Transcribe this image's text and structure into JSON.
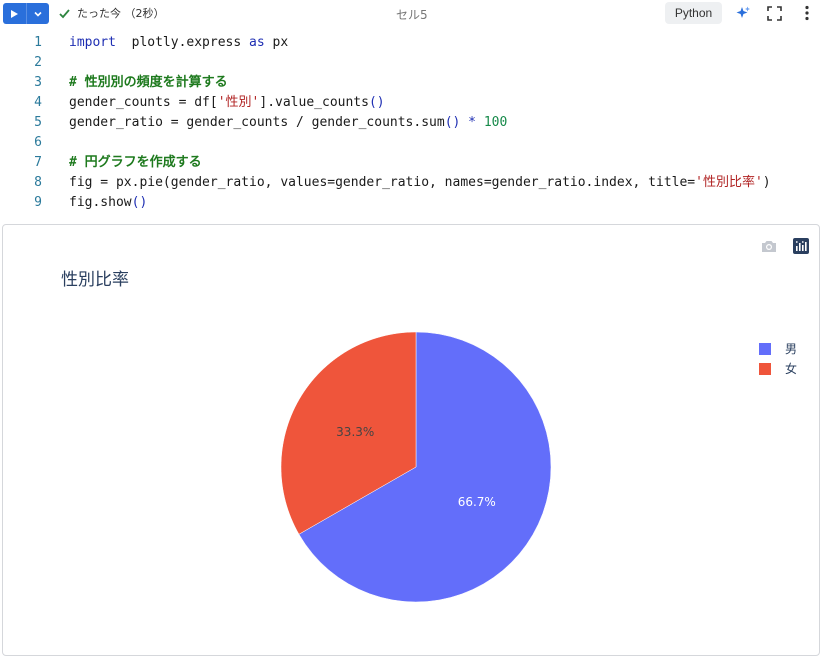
{
  "toolbar": {
    "status_text": "たった今 （2秒）",
    "cell_title": "セル5",
    "language": "Python"
  },
  "code_lines": [
    {
      "n": "1",
      "parts": [
        [
          "kw",
          "import"
        ],
        [
          "",
          "  plotly.express "
        ],
        [
          "kw",
          "as"
        ],
        [
          "",
          " px"
        ]
      ]
    },
    {
      "n": "2",
      "parts": []
    },
    {
      "n": "3",
      "parts": [
        [
          "cm",
          "# 性別別の頻度を計算する"
        ]
      ]
    },
    {
      "n": "4",
      "parts": [
        [
          "",
          "gender_counts = df["
        ],
        [
          "str",
          "'性別'"
        ],
        [
          "",
          "].value_counts"
        ],
        [
          "kw",
          "()"
        ]
      ]
    },
    {
      "n": "5",
      "parts": [
        [
          "",
          "gender_ratio = gender_counts / gender_counts.sum"
        ],
        [
          "kw",
          "()"
        ],
        [
          "",
          " "
        ],
        [
          "kw",
          "*"
        ],
        [
          "",
          " "
        ],
        [
          "num",
          "100"
        ]
      ]
    },
    {
      "n": "6",
      "parts": []
    },
    {
      "n": "7",
      "parts": [
        [
          "cm",
          "# 円グラフを作成する"
        ]
      ]
    },
    {
      "n": "8",
      "parts": [
        [
          "",
          "fig = px.pie(gender_ratio, values=gender_ratio, names=gender_ratio.index, title="
        ],
        [
          "str",
          "'性別比率'"
        ],
        [
          "",
          ")"
        ]
      ]
    },
    {
      "n": "9",
      "parts": [
        [
          "",
          "fig.show"
        ],
        [
          "kw",
          "()"
        ]
      ]
    }
  ],
  "chart_data": {
    "type": "pie",
    "title": "性別比率",
    "categories": [
      "男",
      "女"
    ],
    "values": [
      66.7,
      33.3
    ],
    "labels": [
      "66.7%",
      "33.3%"
    ],
    "colors": [
      "#636efa",
      "#ef553b"
    ],
    "label_colors": [
      "#ffffff",
      "#444444"
    ],
    "legend_position": "top-right"
  }
}
